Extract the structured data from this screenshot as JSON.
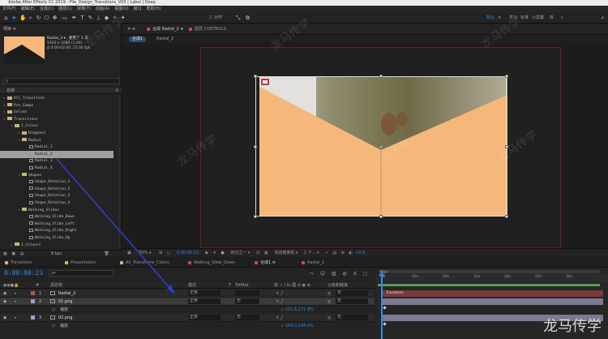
{
  "window": {
    "title": "Adobe After Effects CC 2019 - File_Design_Transitions_V03 | Label | Deep"
  },
  "menu": [
    "文件(F)",
    "编辑(E)",
    "合成(C)",
    "图层(L)",
    "效果(T)",
    "动画(A)",
    "视图(V)",
    "窗口",
    "帮助(H)"
  ],
  "toolbar": {
    "snap_label": "对齐",
    "workspaces": [
      "默认",
      "≡",
      "学习",
      "标准",
      "小屏幕",
      "库",
      "»"
    ],
    "search_icon": "search-icon"
  },
  "project": {
    "tab_label": "项目 ≡",
    "thumb_color": "#f5b77a",
    "item_name": "Radial_3 ▾ , 使用了 1 次",
    "item_res": "1920 x 1080 (1.00)",
    "item_dur": "Δ 0:00:02:00, 25.00 fps",
    "search_placeholder": "ρ",
    "col_name": "名称",
    "tree": [
      {
        "indent": 0,
        "type": "folder",
        "label": "All_Transition",
        "open": false
      },
      {
        "indent": 0,
        "type": "folder",
        "label": "Pre_Comps",
        "open": false
      },
      {
        "indent": 0,
        "type": "folder",
        "label": "Solids",
        "open": false
      },
      {
        "indent": 0,
        "type": "folder",
        "label": "Transitions",
        "open": true
      },
      {
        "indent": 1,
        "type": "folder",
        "label": "1_Colour",
        "open": true
      },
      {
        "indent": 2,
        "type": "folder",
        "label": "Diagonal",
        "open": false
      },
      {
        "indent": 2,
        "type": "folder",
        "label": "Radial",
        "open": true
      },
      {
        "indent": 3,
        "type": "comp",
        "label": "Radial_1",
        "selected": false
      },
      {
        "indent": 3,
        "type": "comp",
        "label": "Radial_2",
        "selected": true
      },
      {
        "indent": 3,
        "type": "comp",
        "label": "Radial_3",
        "selected": false
      },
      {
        "indent": 3,
        "type": "comp",
        "label": "Radial_4",
        "selected": false
      },
      {
        "indent": 2,
        "type": "folder",
        "label": "Shapes",
        "open": true
      },
      {
        "indent": 3,
        "type": "comp",
        "label": "Shape_Rotation_1",
        "selected": false
      },
      {
        "indent": 3,
        "type": "comp",
        "label": "Shape_Rotation_2",
        "selected": false
      },
      {
        "indent": 3,
        "type": "comp",
        "label": "Shape_Rotation_3",
        "selected": false
      },
      {
        "indent": 3,
        "type": "comp",
        "label": "Shape_Rotation_4",
        "selected": false
      },
      {
        "indent": 2,
        "type": "folder",
        "label": "Walking_Slides",
        "open": true
      },
      {
        "indent": 3,
        "type": "comp",
        "label": "Walking_Slide_Down",
        "selected": false
      },
      {
        "indent": 3,
        "type": "comp",
        "label": "Walking_Slide_Left",
        "selected": false
      },
      {
        "indent": 3,
        "type": "comp",
        "label": "Walking_Slide_Right",
        "selected": false
      },
      {
        "indent": 3,
        "type": "comp",
        "label": "Walking_Slide_Up",
        "selected": false
      },
      {
        "indent": 1,
        "type": "folder",
        "label": "2_Colours",
        "open": false
      }
    ],
    "footer": "8 bpc"
  },
  "viewer": {
    "tab_comp": "合成 Radial_2 ≡",
    "tab_layer": "图层 CONTROLS",
    "pill_active": "合成1",
    "pill_other": "Radial_2",
    "footer": {
      "zoom": "50%",
      "time": "0:00:00:23",
      "quality": "四分之一",
      "camera": "活动摄像机",
      "views": "1 个...",
      "offset": "+0.0"
    },
    "canvas_color": "#e9b27c",
    "accent": "#f5b77a"
  },
  "timeline": {
    "tabs": [
      {
        "label": "Transitions",
        "color": "#c8b27a"
      },
      {
        "label": "Presentation",
        "color": "#c8b27a"
      },
      {
        "label": "All_Transitions_Colors",
        "color": "#c8b27a"
      },
      {
        "label": "Walking_Slide_Down",
        "color": "#c8484a"
      },
      {
        "label": "合成1 ≡",
        "color": "#c8484a"
      },
      {
        "label": "Radial_1",
        "color": "#c8484a"
      }
    ],
    "timecode": "0:00:00:23",
    "search_placeholder": "ρ▾",
    "headers": {
      "name": "源名称",
      "mode": "模式",
      "t": "T",
      "trkmat": "TrkMat",
      "switches": "单 ☆ \\ fx 图 ⊘ ◉ ⊕",
      "parent": "父级和链接"
    },
    "layers": [
      {
        "num": "1",
        "name": "Radial_2",
        "mode": "正常",
        "trkmat": "",
        "parent": "无",
        "color": "#c8484a"
      },
      {
        "num": "2",
        "name": "01.png",
        "mode": "正常",
        "trkmat": "无",
        "parent": "无",
        "color": "#a0a0d0"
      },
      {
        "sub": true,
        "label": "缩放",
        "value": "∞ 151.6,171.9%"
      },
      {
        "num": "3",
        "name": "02.png",
        "mode": "正常",
        "trkmat": "无",
        "parent": "无",
        "color": "#a0a0d0"
      },
      {
        "sub": true,
        "label": "缩放",
        "value": "∞ 104.0,104.0%"
      }
    ],
    "ruler": [
      "0s",
      "05s",
      "10s",
      "15s",
      "20s",
      "25s",
      "30s"
    ],
    "bar_label": "Transition"
  },
  "watermark": {
    "text": "龙马传学",
    "logo": "龙马传学"
  }
}
